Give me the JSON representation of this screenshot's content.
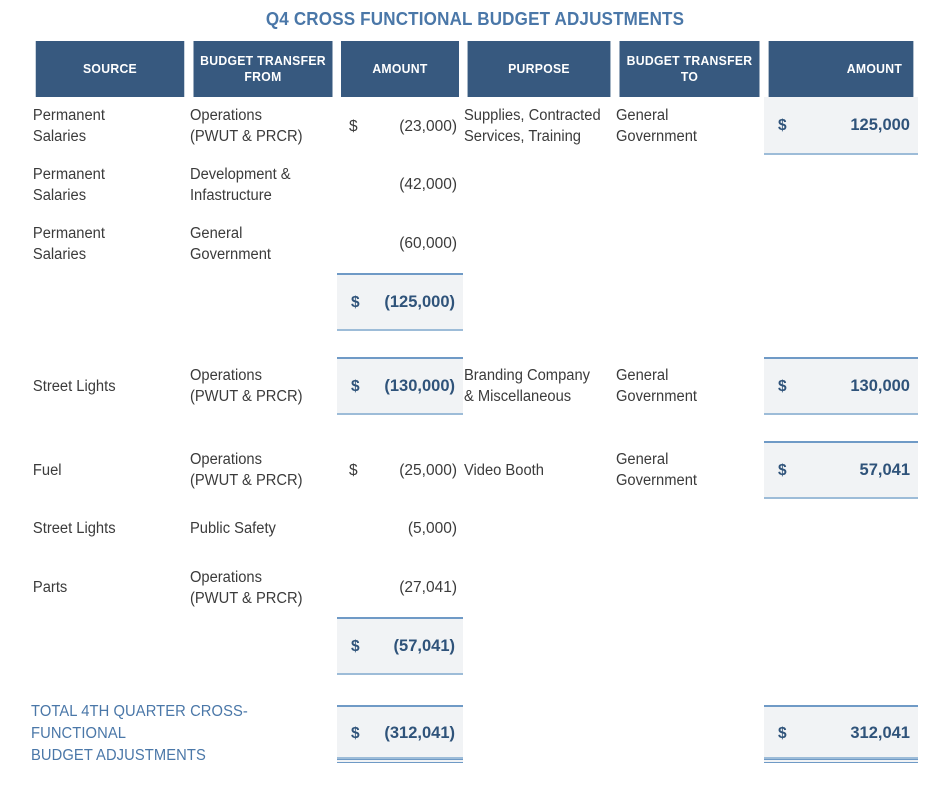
{
  "title": "Q4 CROSS FUNCTIONAL BUDGET ADJUSTMENTS",
  "colors": {
    "header_bg": "#37597F",
    "title_text": "#4A77A8",
    "accent_blue": "#2F537A",
    "cell_highlight_bg": "#F1F3F5",
    "cell_border": "#6F9AC6",
    "body_text": "#3B3B3B"
  },
  "columns": [
    {
      "key": "source",
      "label": "SOURCE"
    },
    {
      "key": "from",
      "label": "BUDGET TRANSFER FROM"
    },
    {
      "key": "amount1",
      "label": "AMOUNT"
    },
    {
      "key": "purpose",
      "label": "PURPOSE"
    },
    {
      "key": "to",
      "label": "BUDGET TRANSFER TO"
    },
    {
      "key": "amount2",
      "label": "AMOUNT"
    }
  ],
  "header": {
    "source": "SOURCE",
    "from_line1": "BUDGET TRANSFER",
    "from_line2": "FROM",
    "amount1": "AMOUNT",
    "purpose": "PURPOSE",
    "to_line1": "BUDGET TRANSFER",
    "to_line2": "TO",
    "amount2": "AMOUNT"
  },
  "currency_symbol": "$",
  "groups": [
    {
      "id": "group-1",
      "rows": [
        {
          "source_line1": "Permanent",
          "source_line2": "Salaries",
          "from_line1": "Operations",
          "from_line2": "(PWUT & PRCR)",
          "amount1_symbol": "$",
          "amount1": "(23,000)",
          "purpose_line1": "Supplies, Contracted",
          "purpose_line2": "Services, Training",
          "to_line1": "General",
          "to_line2": "Government",
          "amount2_symbol": "$",
          "amount2": "125,000"
        },
        {
          "source_line1": "Permanent",
          "source_line2": "Salaries",
          "from_line1": "Development &",
          "from_line2": "Infastructure",
          "amount1_symbol": "",
          "amount1": "(42,000)",
          "purpose_line1": "",
          "purpose_line2": "",
          "to_line1": "",
          "to_line2": "",
          "amount2_symbol": "",
          "amount2": ""
        },
        {
          "source_line1": "Permanent",
          "source_line2": "Salaries",
          "from_line1": "General",
          "from_line2": "Government",
          "amount1_symbol": "",
          "amount1": "(60,000)",
          "purpose_line1": "",
          "purpose_line2": "",
          "to_line1": "",
          "to_line2": "",
          "amount2_symbol": "",
          "amount2": ""
        }
      ],
      "subtotal": {
        "symbol": "$",
        "value": "(125,000)"
      }
    },
    {
      "id": "group-2",
      "rows": [
        {
          "source_line1": "Street Lights",
          "source_line2": "",
          "from_line1": "Operations",
          "from_line2": "(PWUT & PRCR)",
          "amount1_symbol": "$",
          "amount1": "(130,000)",
          "purpose_line1": "Branding Company",
          "purpose_line2": "& Miscellaneous",
          "to_line1": "General",
          "to_line2": "Government",
          "amount2_symbol": "$",
          "amount2": "130,000"
        }
      ]
    },
    {
      "id": "group-3",
      "rows": [
        {
          "source_line1": "Fuel",
          "source_line2": "",
          "from_line1": "Operations",
          "from_line2": "(PWUT & PRCR)",
          "amount1_symbol": "$",
          "amount1": "(25,000)",
          "purpose_line1": "Video Booth",
          "purpose_line2": "",
          "to_line1": "General",
          "to_line2": "Government",
          "amount2_symbol": "$",
          "amount2": "57,041"
        },
        {
          "source_line1": "Street Lights",
          "source_line2": "",
          "from_line1": "Public Safety",
          "from_line2": "",
          "amount1_symbol": "",
          "amount1": "(5,000)",
          "purpose_line1": "",
          "purpose_line2": "",
          "to_line1": "",
          "to_line2": "",
          "amount2_symbol": "",
          "amount2": ""
        },
        {
          "source_line1": "Parts",
          "source_line2": "",
          "from_line1": "Operations",
          "from_line2": "(PWUT & PRCR)",
          "amount1_symbol": "",
          "amount1": "(27,041)",
          "purpose_line1": "",
          "purpose_line2": "",
          "to_line1": "",
          "to_line2": "",
          "amount2_symbol": "",
          "amount2": ""
        }
      ],
      "subtotal": {
        "symbol": "$",
        "value": "(57,041)"
      }
    }
  ],
  "total": {
    "label_line1": "TOTAL 4TH QUARTER CROSS-FUNCTIONAL",
    "label_line2": "BUDGET ADJUSTMENTS",
    "amount1_symbol": "$",
    "amount1": "(312,041)",
    "amount2_symbol": "$",
    "amount2": "312,041"
  }
}
